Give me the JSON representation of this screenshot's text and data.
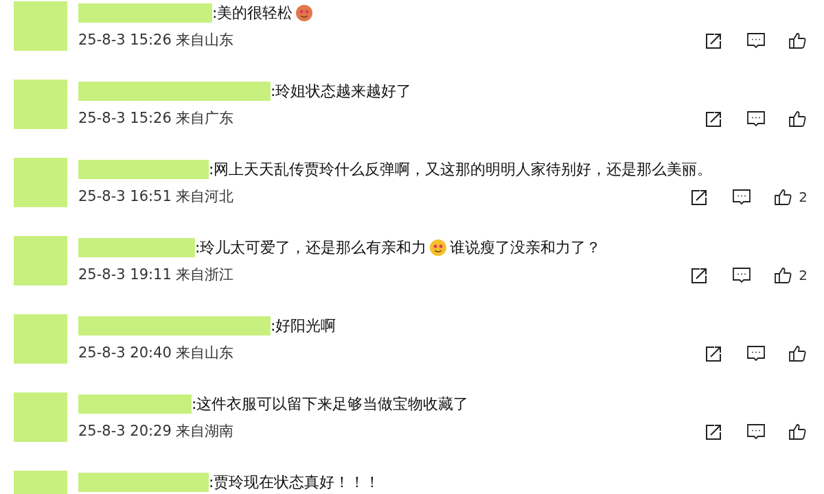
{
  "comments": [
    {
      "parts": [
        {
          "kind": "text",
          "text": ":美的很轻松"
        },
        {
          "kind": "emoji",
          "color": "#e07a4a"
        }
      ],
      "meta": "25-8-3 15:26 来自山东"
    },
    {
      "parts": [
        {
          "kind": "text",
          "text": ":玲姐状态越来越好了"
        }
      ],
      "meta": "25-8-3 15:26 来自广东"
    },
    {
      "parts": [
        {
          "kind": "text",
          "text": ":网上天天乱传贾玲什么反弹啊，又这那的明明人家待别好，还是那么美丽。"
        }
      ],
      "meta": "25-8-3 16:51 来自河北",
      "likes": "2"
    },
    {
      "parts": [
        {
          "kind": "text",
          "text": ":玲儿太可爱了，还是那么有亲和力"
        },
        {
          "kind": "emoji",
          "color": "#f5c02a"
        },
        {
          "kind": "text",
          "text": " 谁说瘦了没亲和力了？"
        }
      ],
      "meta": "25-8-3 19:11 来自浙江",
      "likes": "2"
    },
    {
      "parts": [
        {
          "kind": "text",
          "text": ":好阳光啊"
        }
      ],
      "meta": "25-8-3 20:40 来自山东"
    },
    {
      "parts": [
        {
          "kind": "text",
          "text": ":这件衣服可以留下来足够当做宝物收藏了"
        }
      ],
      "meta": "25-8-3 20:29 来自湖南"
    },
    {
      "parts": [
        {
          "kind": "text",
          "text": ":贾玲现在状态真好！！！"
        }
      ]
    }
  ]
}
